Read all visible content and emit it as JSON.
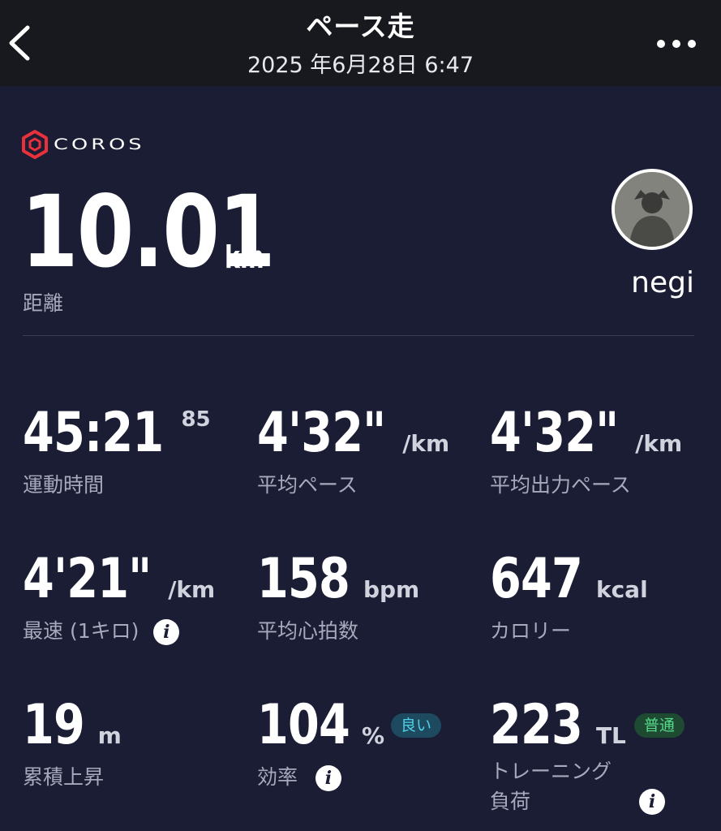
{
  "header": {
    "title": "ペース走",
    "datetime": "2025 年6月28日 6:47",
    "back_icon": "chevron-left-icon",
    "more_icon": "more-horizontal-icon"
  },
  "brand": {
    "name": "COROS",
    "logo_color": "#e8313b"
  },
  "summary": {
    "distance_value": "10.01",
    "distance_unit": "km",
    "distance_label": "距離",
    "username": "negi"
  },
  "stats": {
    "time": {
      "value": "45:21",
      "unit": "85",
      "label": "運動時間"
    },
    "avg_pace": {
      "value": "4'32\"",
      "unit": "/km",
      "label": "平均ペース"
    },
    "avg_power_pace": {
      "value": "4'32\"",
      "unit": "/km",
      "label": "平均出力ペース"
    },
    "best_pace": {
      "value": "4'21\"",
      "unit": "/km",
      "label": "最速 (1キロ)"
    },
    "avg_hr": {
      "value": "158",
      "unit": "bpm",
      "label": "平均心拍数"
    },
    "calories": {
      "value": "647",
      "unit": "kcal",
      "label": "カロリー"
    },
    "ascent": {
      "value": "19",
      "unit": "m",
      "label": "累積上昇"
    },
    "efficiency": {
      "value": "104",
      "unit": "%",
      "badge": "良い",
      "label": "効率"
    },
    "training_load": {
      "value": "223",
      "unit": "TL",
      "badge": "普通",
      "label_line1": "トレーニング",
      "label_line2": "負荷"
    }
  },
  "colors": {
    "background": "#1a1d33",
    "header_bg": "#17191f",
    "label": "#a7a9bc",
    "badge_good_bg": "#1d4a5e",
    "badge_good_text": "#4fd0e8",
    "badge_normal_bg": "#1e4a32",
    "badge_normal_text": "#56d98a"
  }
}
